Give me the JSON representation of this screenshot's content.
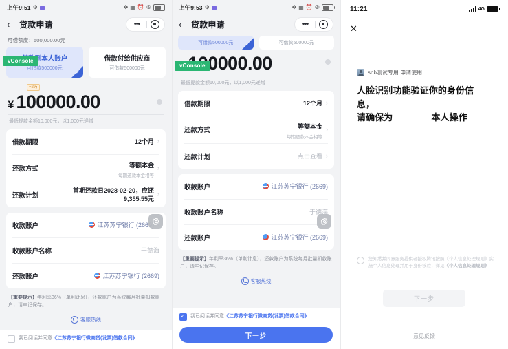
{
  "panel1": {
    "statusbar": {
      "time": "上午9:51",
      "icons": [
        "gear-icon",
        "app-icon",
        "bluetooth-icon",
        "vibrate-icon",
        "alarm-icon",
        "wifi-icon",
        "battery-icon"
      ]
    },
    "nav": {
      "back": "‹",
      "title": "贷款申请",
      "menu_dots": "•••"
    },
    "quota_label": "可借额度：500,000.00元",
    "mode_cards": [
      {
        "title": "借款到本人账户",
        "sub": "可借款500000元",
        "selected": true
      },
      {
        "title": "借款付给供应商",
        "sub": "可借款500000元",
        "selected": false
      }
    ],
    "amount": {
      "badge": "+2万",
      "currency": "¥",
      "value": "100000.00",
      "hint": "最低提款金额10,000元，以1,000元递增"
    },
    "form_rows": [
      {
        "label": "借款期限",
        "value": "12个月",
        "sub": "",
        "style": "bold",
        "chevron": true
      },
      {
        "label": "还款方式",
        "value": "等额本金",
        "sub": "每期还款本金相等",
        "style": "bold",
        "chevron": true
      },
      {
        "label": "还款计划",
        "value": "首期还款日2028-02-20，应还9,355.55元",
        "sub": "",
        "style": "twoline",
        "chevron": true
      }
    ],
    "account_rows": [
      {
        "label": "收款账户",
        "value": "江苏苏宁银行 (2669)",
        "style": "blue",
        "bank": true,
        "chevron": true
      },
      {
        "label": "收款账户名称",
        "value": "于德海",
        "style": "muted",
        "bank": false,
        "chevron": false
      },
      {
        "label": "还款账户",
        "value": "江苏苏宁银行 (2669)",
        "style": "blue",
        "bank": true,
        "chevron": false
      }
    ],
    "notes_bold": "【重要提示】",
    "notes_text": "年利率36%（单利计息），还款账户为系统每月批量扣款账户，请牢记保存。",
    "hotline": "客服热线",
    "agreement": {
      "checked": false,
      "prefix": "我已阅读并同意",
      "link": "《江苏苏宁银行微商贷(发票)借款合同》"
    },
    "vconsole": "vConsole"
  },
  "panel2": {
    "statusbar": {
      "time": "上午9:53"
    },
    "nav": {
      "back": "‹",
      "title": "贷款申请",
      "menu_dots": "•••"
    },
    "tabs": [
      {
        "sub": "可借款500000元",
        "selected": true
      },
      {
        "sub": "可借款500000元",
        "selected": false
      }
    ],
    "amount": {
      "currency": "¥",
      "value": "100000.00",
      "hint": "最低提款金额10,000元，以1,000元递增"
    },
    "form_rows": [
      {
        "label": "借款期限",
        "value": "12个月",
        "sub": "",
        "style": "bold",
        "chevron": true
      },
      {
        "label": "还款方式",
        "value": "等额本金",
        "sub": "每期还款本金相等",
        "style": "bold",
        "chevron": true
      },
      {
        "label": "还款计划",
        "value": "点击查看",
        "sub": "",
        "style": "muted",
        "chevron": true
      }
    ],
    "account_rows": [
      {
        "label": "收款账户",
        "value": "江苏苏宁银行 (2669)",
        "style": "blue",
        "bank": true,
        "chevron": false
      },
      {
        "label": "收款账户名称",
        "value": "于德海",
        "style": "muted",
        "bank": false,
        "chevron": false
      },
      {
        "label": "还款账户",
        "value": "江苏苏宁银行 (2669)",
        "style": "blue",
        "bank": true,
        "chevron": false
      }
    ],
    "notes_bold": "【重要提示】",
    "notes_text": "年利率36%（单利计息），还款账户为系统每月批量扣款账户，请牢记保存。",
    "hotline": "客服热线",
    "agreement": {
      "checked": true,
      "prefix": "我已阅读并同意",
      "link": "《江苏苏宁银行微商贷(发票)借款合同》"
    },
    "next_button": "下一步",
    "vconsole": "vConsole"
  },
  "panel3": {
    "statusbar": {
      "time": "11:21",
      "network": "4G"
    },
    "close_icon": "✕",
    "app_line": "snb测试专用 申请使用",
    "headline_1": "人脸识别功能验证你的身份信息，",
    "headline_2": "请确保为",
    "headline_3": "本人操作",
    "consent": "您知悉并同意服务提供者授权腾讯按照《个人信息处理规则》实施个人信息处理并用于身份核验，详见",
    "consent_link": "《个人信息处理规则》",
    "next_button": "下一步",
    "feedback": "意见反馈"
  },
  "colors": {
    "accent": "#4a74ef",
    "selected_bg": "#dfe6fb",
    "page_bg": "#f2f3f5",
    "vconsole": "#2bb673"
  }
}
